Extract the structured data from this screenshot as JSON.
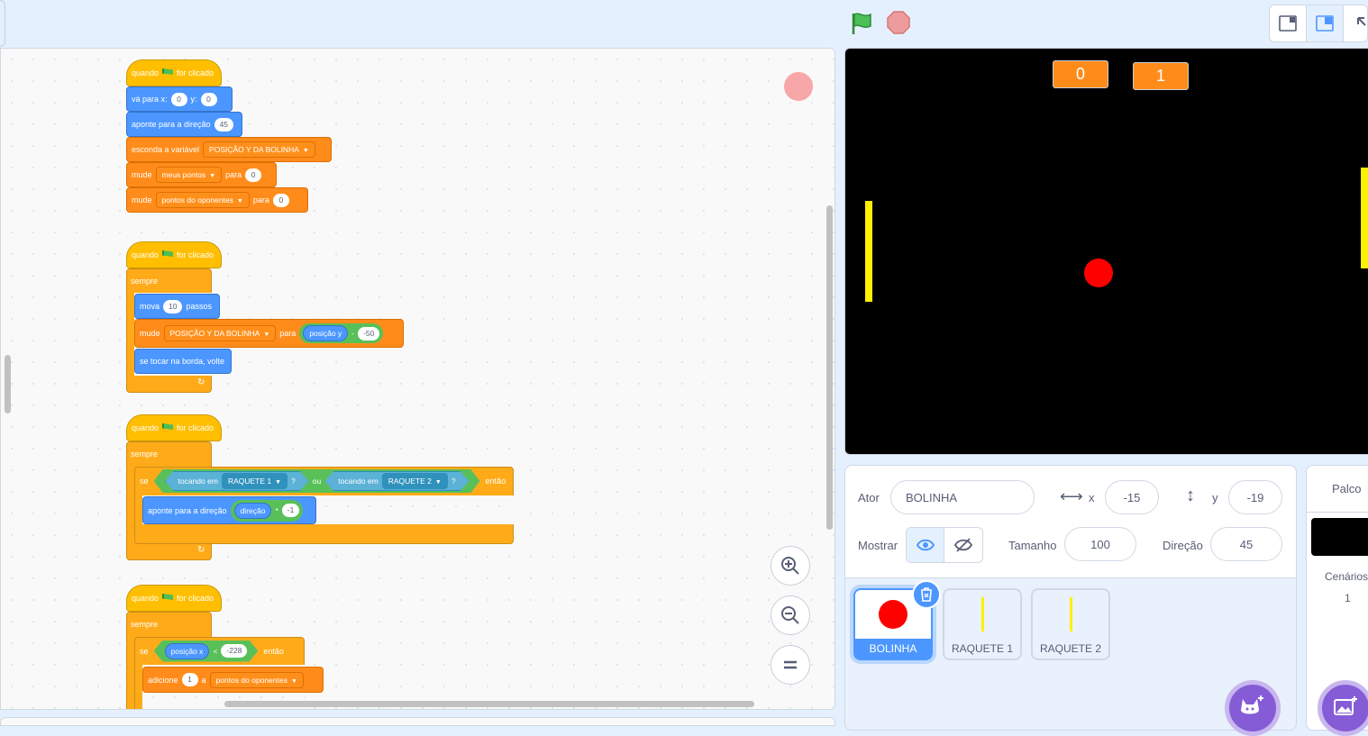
{
  "scripts": {
    "s1": {
      "hat_quando": "quando",
      "hat_clicked": "for clicado",
      "goto_label": "vá para x:",
      "goto_x": "0",
      "goto_y_label": "y:",
      "goto_y": "0",
      "point_label": "aponte para a direção",
      "point_val": "45",
      "hide_label": "esconda a variável",
      "hide_var": "POSIÇÃO Y DA BOLINHA",
      "set1_label": "mude",
      "set1_var": "meus pontos",
      "set1_to": "para",
      "set1_val": "0",
      "set2_label": "mude",
      "set2_var": "pontos do oponentes",
      "set2_to": "para",
      "set2_val": "0"
    },
    "s2": {
      "hat_quando": "quando",
      "hat_clicked": "for clicado",
      "forever": "sempre",
      "move_label": "mova",
      "move_val": "10",
      "move_unit": "passos",
      "set_label": "mude",
      "set_var": "POSIÇÃO Y DA BOLINHA",
      "set_to": "para",
      "set_rep": "posição y",
      "set_op": "-",
      "set_val": "-50",
      "bounce": "se tocar na borda, volte"
    },
    "s3": {
      "hat_quando": "quando",
      "hat_clicked": "for clicado",
      "forever": "sempre",
      "if_label": "se",
      "touch1_label": "tocando em",
      "touch1_obj": "RAQUETE 1",
      "q1": "?",
      "or_label": "ou",
      "touch2_label": "tocando em",
      "touch2_obj": "RAQUETE 2",
      "q2": "?",
      "then_label": "então",
      "point_label": "aponte para a direção",
      "point_rep": "direção",
      "point_op": "*",
      "point_val": "-1"
    },
    "s4": {
      "hat_quando": "quando",
      "hat_clicked": "for clicado",
      "forever": "sempre",
      "if_label": "se",
      "cond_rep": "posição x",
      "cond_op": "<",
      "cond_val": "-228",
      "then_label": "então",
      "change_label": "adicione",
      "change_val": "1",
      "change_a": "a",
      "change_var": "pontos do oponentes"
    }
  },
  "stage": {
    "score_left": "0",
    "score_right": "1"
  },
  "sprite_info": {
    "sprite_label": "Ator",
    "sprite_name": "BOLINHA",
    "x_label": "x",
    "x_value": "-15",
    "y_label": "y",
    "y_value": "-19",
    "show_label": "Mostrar",
    "size_label": "Tamanho",
    "size_value": "100",
    "direction_label": "Direção",
    "direction_value": "45"
  },
  "sprites": [
    {
      "name": "BOLINHA"
    },
    {
      "name": "RAQUETE 1"
    },
    {
      "name": "RAQUETE 2"
    }
  ],
  "stage_panel": {
    "title": "Palco",
    "backdrops_label": "Cenários",
    "backdrops_count": "1"
  },
  "colors": {
    "events": "#ffbf00",
    "motion": "#4c97ff",
    "variables": "#ff8c1a",
    "operators": "#59c059",
    "control": "#ffab19",
    "sensing": "#5cb1d6",
    "accent": "#855cd6",
    "selected": "#4c97ff"
  }
}
